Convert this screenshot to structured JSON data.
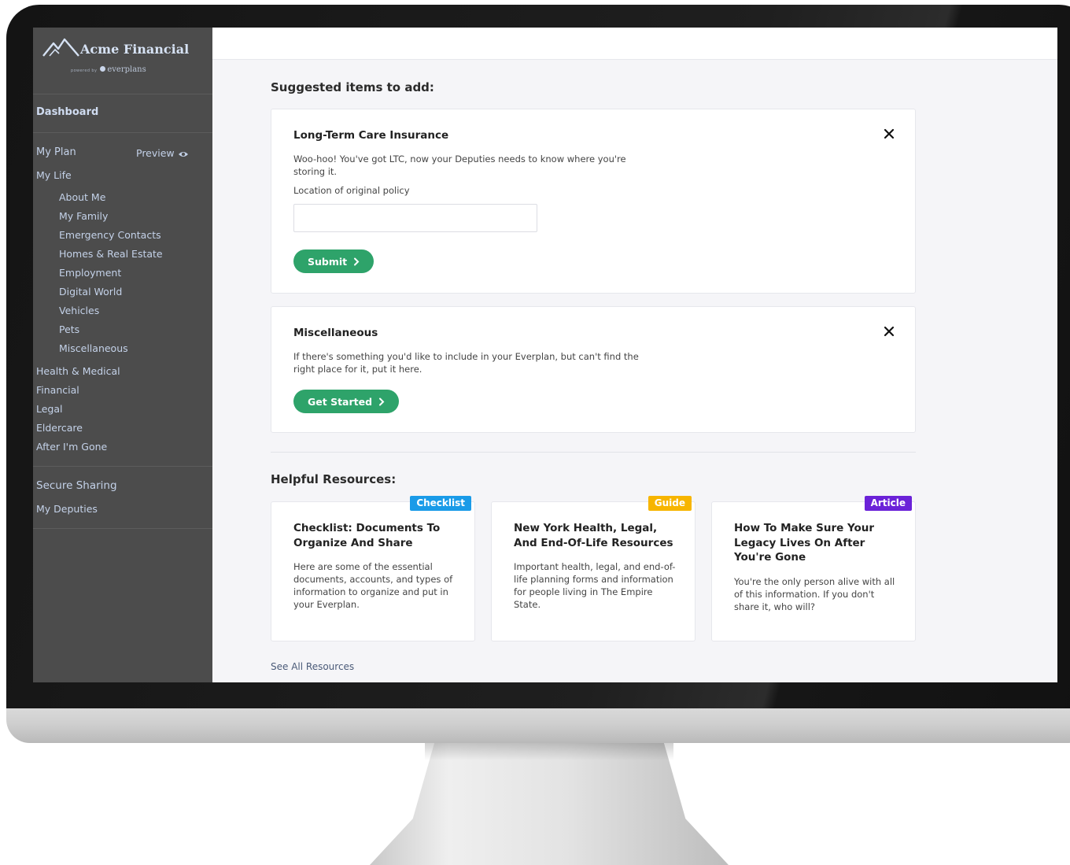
{
  "brand": {
    "name": "Acme Financial",
    "powered_by": "powered by",
    "partner": "everplans"
  },
  "sidebar": {
    "dashboard": "Dashboard",
    "my_plan": "My Plan",
    "preview": "Preview",
    "my_life": "My Life",
    "life_items": [
      "About Me",
      "My Family",
      "Emergency Contacts",
      "Homes & Real Estate",
      "Employment",
      "Digital World",
      "Vehicles",
      "Pets",
      "Miscellaneous"
    ],
    "sections": [
      "Health & Medical",
      "Financial",
      "Legal",
      "Eldercare",
      "After I'm Gone"
    ],
    "secure_sharing": "Secure Sharing",
    "my_deputies": "My Deputies"
  },
  "suggested": {
    "heading": "Suggested items to add:",
    "ltc": {
      "title": "Long-Term Care Insurance",
      "text": "Woo-hoo! You've got LTC, now your Deputies needs to know where you're storing it.",
      "field_label": "Location of original policy",
      "field_value": "",
      "button": "Submit"
    },
    "misc": {
      "title": "Miscellaneous",
      "text": "If there's something you'd like to include in your Everplan, but can't find the right place for it, put it here.",
      "button": "Get Started"
    }
  },
  "resources": {
    "heading": "Helpful Resources:",
    "cards": [
      {
        "badge": "Checklist",
        "badge_color": "#1a9be8",
        "title": "Checklist: Documents To Organize And Share",
        "text": "Here are some of the essential documents, accounts, and types of information to organize and put in your Everplan."
      },
      {
        "badge": "Guide",
        "badge_color": "#f7b500",
        "title": "New York Health, Legal, And End-Of-Life Resources",
        "text": "Important health, legal, and end-of-life planning forms and information for people living in The Empire State."
      },
      {
        "badge": "Article",
        "badge_color": "#6b22d8",
        "title": "How To Make Sure Your Legacy Lives On After You're Gone",
        "text": "You're the only person alive with all of this information. If you don't share it, who will?"
      }
    ],
    "see_all": "See All Resources"
  },
  "colors": {
    "sidebar_bg": "#4c4c4c",
    "accent_green": "#2ea36a",
    "page_bg": "#f5f5f8"
  }
}
